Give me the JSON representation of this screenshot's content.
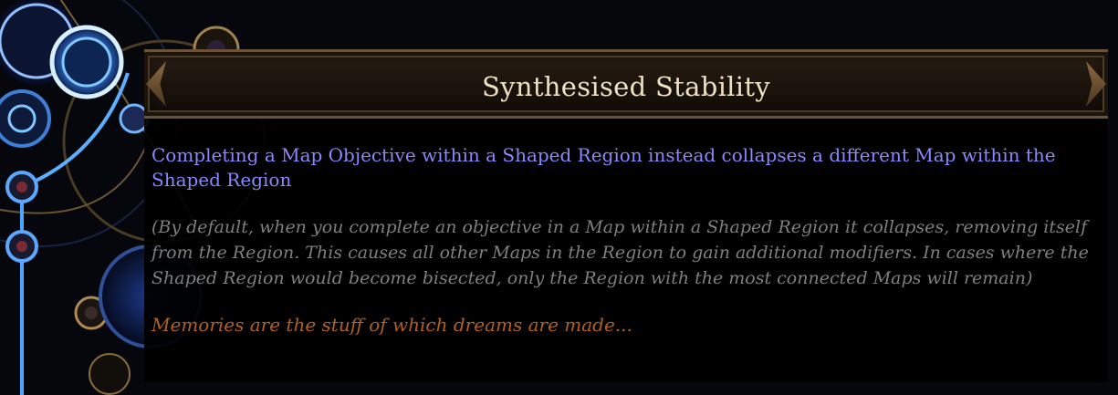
{
  "tooltip": {
    "title": "Synthesised Stability",
    "explicit_mod": "Completing a Map Objective within a Shaped Region instead collapses a different Map within the Shaped Region",
    "reminder_text": "(By default, when you complete an objective in a Map within a Shaped Region it collapses, removing itself from the Region. This causes all other Maps in the Region to gain additional modifiers. In cases where the Shaped Region would become bisected, only the Region with the most connected Maps will remain)",
    "flavour_text": "Memories are the stuff of which dreams are made..."
  },
  "colors": {
    "title": "#f0e0c2",
    "explicit": "#8888ff",
    "reminder": "#7f7f7f",
    "flavour": "#af6025",
    "frame": "#6b5436"
  }
}
